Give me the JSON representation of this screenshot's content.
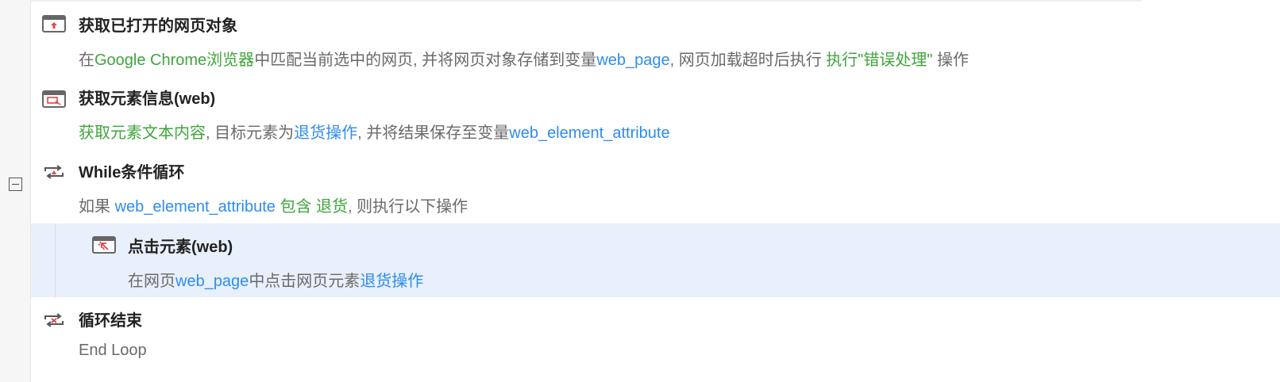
{
  "steps": [
    {
      "title": "获取已打开的网页对象",
      "icon": "browser-open-icon",
      "desc": [
        "在",
        "Google Chrome浏览器",
        "中匹配当前选中的网页, 并将网页对象存储到变量",
        "web_page",
        ", 网页加载超时后执行 ",
        "执行\"错误处理\"",
        " 操作"
      ]
    },
    {
      "title": "获取元素信息(web)",
      "icon": "element-info-icon",
      "desc": [
        "获取元素文本内容",
        ", 目标元素为",
        "退货操作",
        ", 并将结果保存至变量",
        "web_element_attribute"
      ]
    },
    {
      "title": "While条件循环",
      "icon": "while-loop-icon",
      "desc": [
        "如果 ",
        "web_element_attribute",
        " 包含 ",
        "退货",
        ", 则执行以下操作"
      ]
    },
    {
      "title": "点击元素(web)",
      "icon": "click-element-icon",
      "desc": [
        "在网页",
        "web_page",
        "中点击网页元素",
        "退货操作"
      ]
    },
    {
      "title": "循环结束",
      "icon": "loop-end-icon",
      "desc": [
        "End Loop"
      ]
    }
  ],
  "colors": {
    "green": "#3fa53c",
    "blue": "#2f8cf0",
    "selected": "#e8f0fb"
  }
}
